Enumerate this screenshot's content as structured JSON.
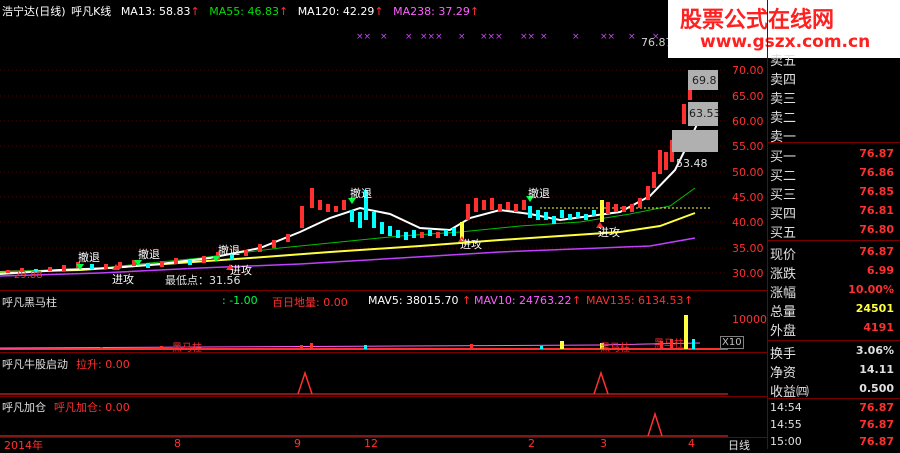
{
  "main_header": {
    "stock": "浩宁达(日线)",
    "indicator": "呼凡K线",
    "ma13": "MA13: 58.83",
    "ma55": "MA55: 46.83",
    "ma120": "MA120: 42.29",
    "ma238": "MA238: 37.29",
    "arrow": "↑"
  },
  "price_axis": [
    "70.00",
    "65.00",
    "60.00",
    "55.00",
    "50.00",
    "45.00",
    "40.00",
    "35.00",
    "30.00"
  ],
  "chart_labels": {
    "high": "76.87",
    "p698": "69.8",
    "p6353": "63.53",
    "p5348": "53.48",
    "low_label": "最低点：31.56",
    "left_price": "29.88",
    "retreat": "撤退",
    "attack": "进攻"
  },
  "vol_panel": {
    "title": "呼凡黑马柱",
    "val1": ": -1.00",
    "baili": "百日地量: 0.00",
    "mav5": "MAV5: 38015.70",
    "mav10": "MAV10: 24763.22",
    "mav135": "MAV135: 6134.53",
    "axis_top": "10000",
    "x10": "X10",
    "heima": "黑马柱"
  },
  "ind1": {
    "title": "呼凡牛股启动",
    "label": "拉升: 0.00"
  },
  "ind2": {
    "title": "呼凡加仓",
    "label": "呼凡加仓: 0.00"
  },
  "x_axis": {
    "year": "2014年",
    "ticks": [
      "8",
      "9",
      "12",
      "2",
      "3",
      "4"
    ],
    "period": "日线"
  },
  "watermark": {
    "title": "股票公式在线网",
    "url": "www.gszx.com.cn"
  },
  "order_book": [
    {
      "label": "卖五",
      "value": ""
    },
    {
      "label": "卖四",
      "value": ""
    },
    {
      "label": "卖三",
      "value": ""
    },
    {
      "label": "卖二",
      "value": ""
    },
    {
      "label": "卖一",
      "value": ""
    },
    {
      "label": "买一",
      "value": "76.87"
    },
    {
      "label": "买二",
      "value": "76.86"
    },
    {
      "label": "买三",
      "value": "76.85"
    },
    {
      "label": "买四",
      "value": "76.81"
    },
    {
      "label": "买五",
      "value": "76.80"
    }
  ],
  "quote": [
    {
      "label": "现价",
      "value": "76.87",
      "color": "#ff3030"
    },
    {
      "label": "涨跌",
      "value": "6.99",
      "color": "#ff3030"
    },
    {
      "label": "涨幅",
      "value": "10.00%",
      "color": "#ff3030"
    },
    {
      "label": "总量",
      "value": "24501",
      "color": "#ffff40"
    },
    {
      "label": "外盘",
      "value": "4191",
      "color": "#ff3030"
    }
  ],
  "stats": [
    {
      "label": "换手",
      "value": "3.06%"
    },
    {
      "label": "净资",
      "value": "14.11"
    },
    {
      "label": "收益㈣",
      "value": "0.500"
    }
  ],
  "ticks": [
    {
      "time": "14:54",
      "price": "76.87"
    },
    {
      "time": "14:55",
      "price": "76.87"
    },
    {
      "time": "15:00",
      "price": "76.87"
    }
  ],
  "colors": {
    "up": "#ff3030",
    "down": "#00ffff",
    "ma13": "#ffffff",
    "ma55": "#00c000",
    "ma120": "#ffff40",
    "ma238": "#c040ff"
  }
}
